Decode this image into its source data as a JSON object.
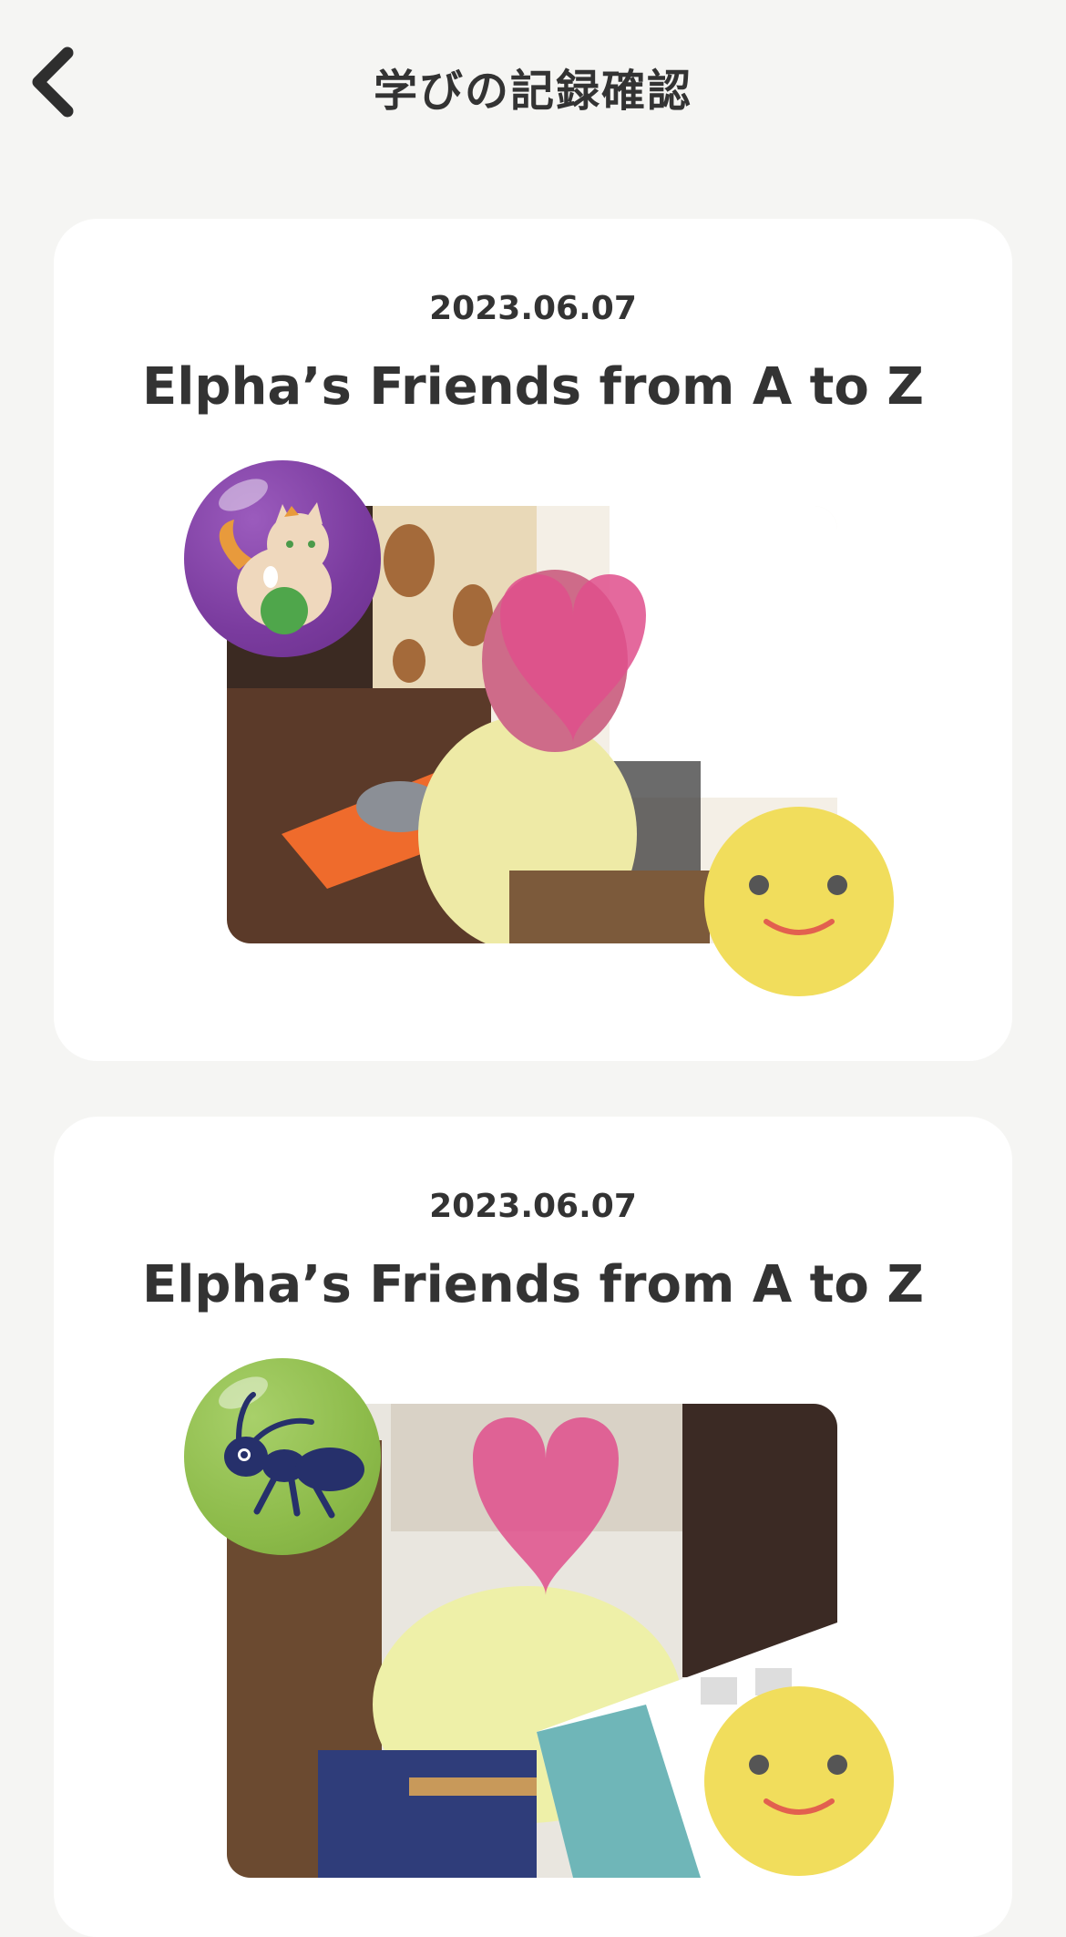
{
  "header": {
    "title": "学びの記録確認",
    "back_icon": "chevron-left-icon"
  },
  "records": [
    {
      "date": "2023.06.07",
      "title": "Elpha’s Friends from A to Z",
      "badge_icon": "cat-icon",
      "badge_color": "#7a3b9e",
      "rating_icon": "smiley-face-icon",
      "rating_color": "#f1dd5c"
    },
    {
      "date": "2023.06.07",
      "title": "Elpha’s Friends from A to Z",
      "badge_icon": "ant-icon",
      "badge_color": "#8dbb4a",
      "rating_icon": "smiley-face-icon",
      "rating_color": "#f1dd5c"
    }
  ]
}
